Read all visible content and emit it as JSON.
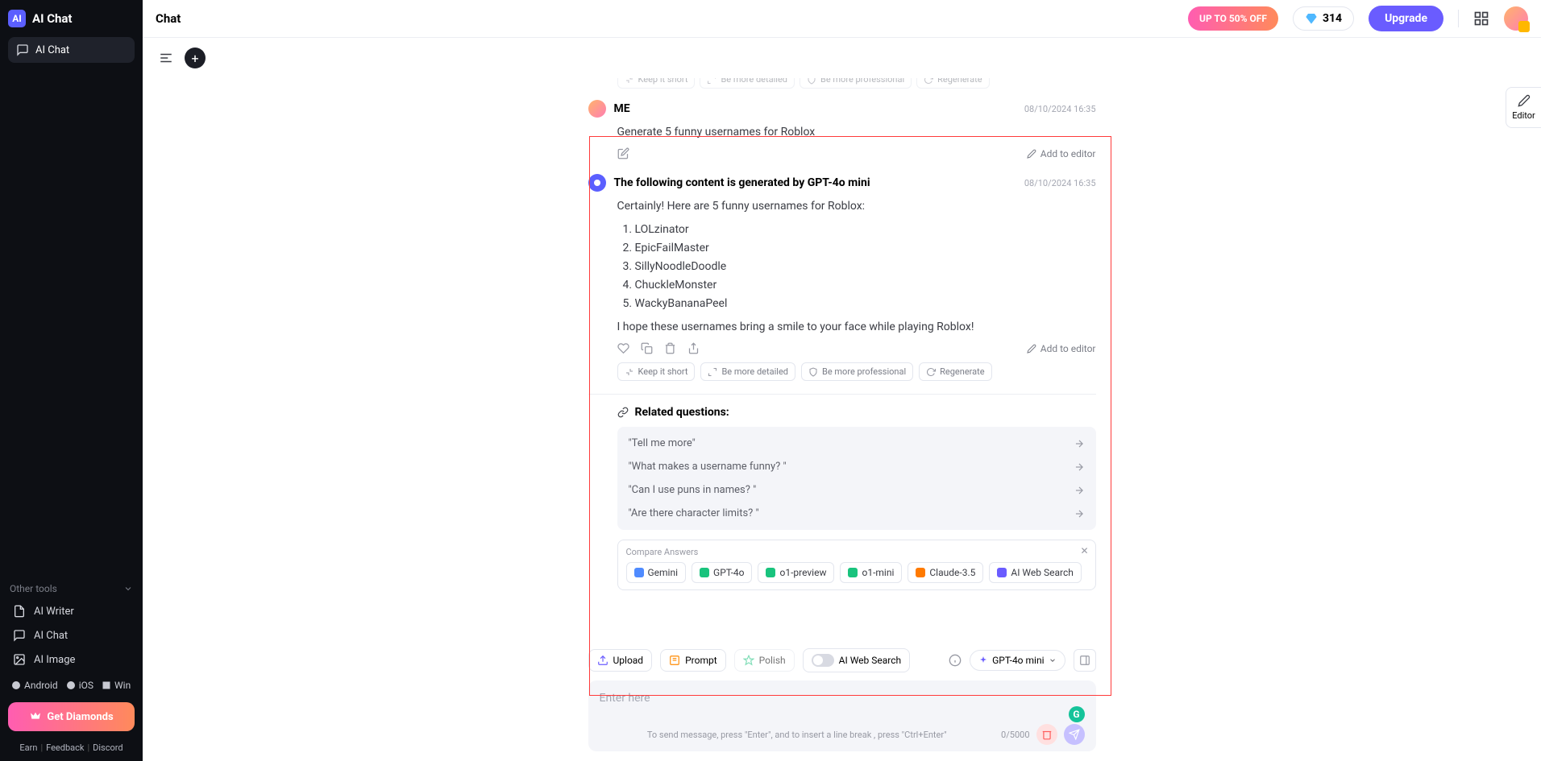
{
  "app": {
    "name": "AI Chat"
  },
  "sidebar": {
    "active_item": "AI Chat",
    "other_tools_header": "Other tools",
    "tools": [
      {
        "label": "AI Writer"
      },
      {
        "label": "AI Chat"
      },
      {
        "label": "AI Image"
      }
    ],
    "platforms": [
      "Android",
      "iOS",
      "Win"
    ],
    "get_diamonds": "Get Diamonds",
    "footer": [
      "Earn",
      "Feedback",
      "Discord"
    ]
  },
  "header": {
    "title": "Chat",
    "promo": "UP TO 50% OFF",
    "diamonds": "314",
    "upgrade": "Upgrade"
  },
  "peek_actions": [
    "Keep it short",
    "Be more detailed",
    "Be more professional",
    "Regenerate"
  ],
  "messages": {
    "user": {
      "sender": "ME",
      "time": "08/10/2024 16:35",
      "text": "Generate 5 funny usernames for Roblox",
      "add_editor": "Add to editor"
    },
    "ai": {
      "sender_prefix": "The following content is generated by ",
      "model": "GPT-4o mini",
      "time": "08/10/2024 16:35",
      "intro": "Certainly! Here are 5 funny usernames for Roblox:",
      "items": [
        "LOLzinator",
        "EpicFailMaster",
        "SillyNoodleDoodle",
        "ChuckleMonster",
        "WackyBananaPeel"
      ],
      "outro": "I hope these usernames bring a smile to your face while playing Roblox!",
      "add_editor": "Add to editor"
    },
    "actions": [
      "Keep it short",
      "Be more detailed",
      "Be more professional",
      "Regenerate"
    ]
  },
  "related": {
    "title": "Related questions:",
    "items": [
      "\"Tell me more\"",
      "\"What makes a username funny? \"",
      "\"Can I use puns in names? \"",
      "\"Are there character limits? \""
    ]
  },
  "compare": {
    "title": "Compare Answers",
    "models": [
      {
        "label": "Gemini",
        "color": "#4f8bff"
      },
      {
        "label": "GPT-4o",
        "color": "#19c37d"
      },
      {
        "label": "o1-preview",
        "color": "#19c37d"
      },
      {
        "label": "o1-mini",
        "color": "#19c37d"
      },
      {
        "label": "Claude-3.5",
        "color": "#ff7a00"
      },
      {
        "label": "AI Web Search",
        "color": "#6a5cff"
      }
    ]
  },
  "input": {
    "upload": "Upload",
    "prompt": "Prompt",
    "polish": "Polish",
    "web_search": "AI Web Search",
    "model": "GPT-4o mini",
    "placeholder": "Enter here",
    "hint": "To send message, press \"Enter\", and to insert a line break , press \"Ctrl+Enter\"",
    "count": "0/5000"
  },
  "editor_tab": "Editor"
}
